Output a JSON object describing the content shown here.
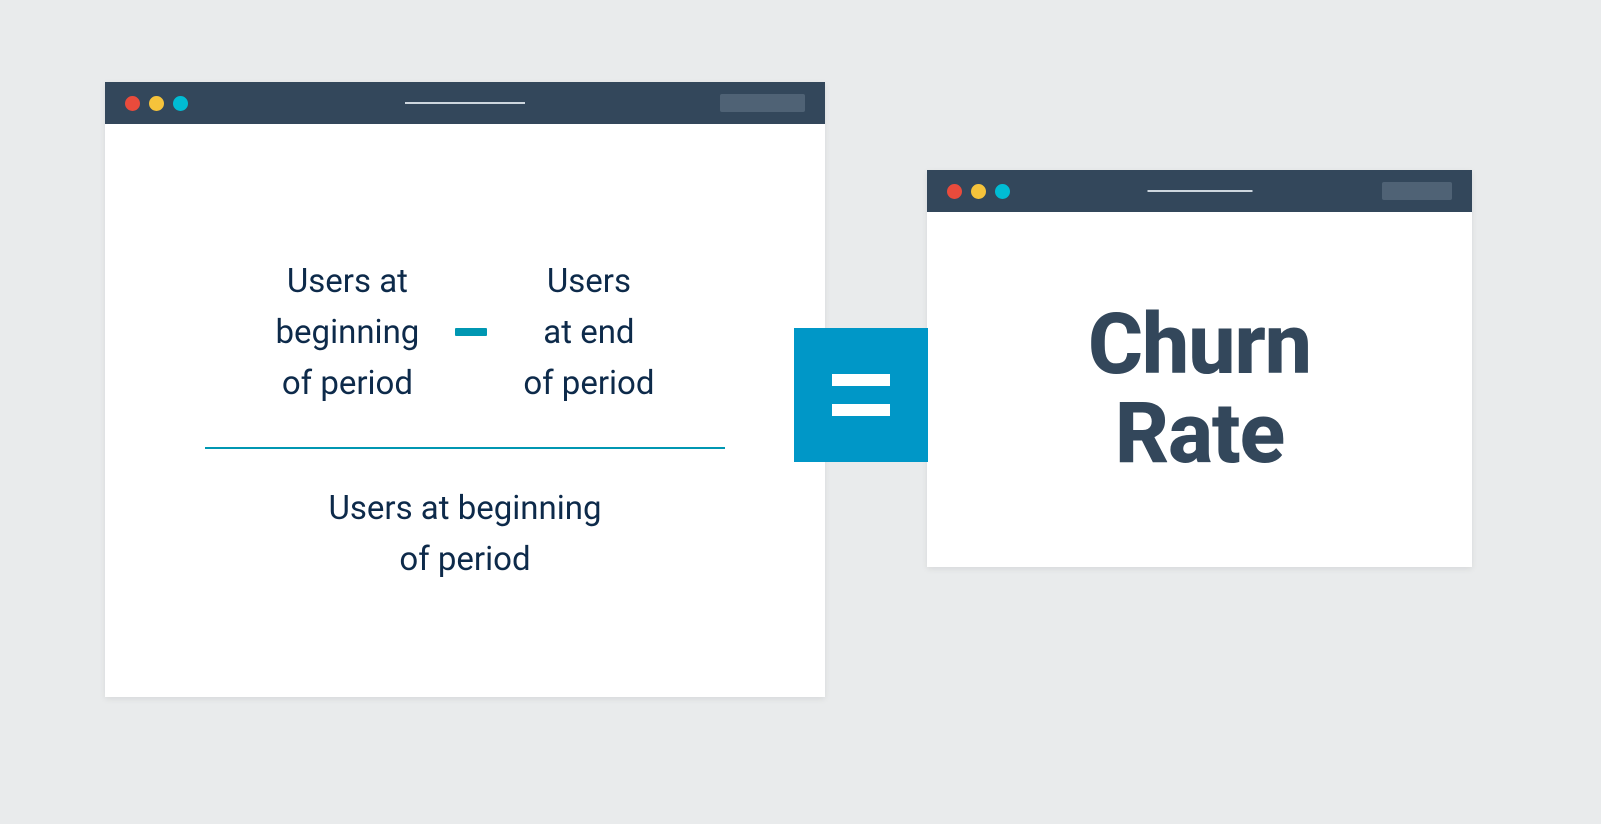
{
  "colors": {
    "background": "#e9ebec",
    "titlebar": "#33475b",
    "accent_teal": "#0097b2",
    "equals_block": "#0097c7",
    "text_dark": "#0d2a4a",
    "result_text": "#33475b",
    "dot_red": "#e94b3c",
    "dot_yellow": "#f5c33b",
    "dot_teal": "#00bcd4"
  },
  "formula": {
    "numerator_left": "Users at\nbeginning\nof period",
    "operator": "minus",
    "numerator_right": "Users\nat end\nof period",
    "denominator": "Users at beginning\nof period"
  },
  "equals": {
    "symbol": "equals"
  },
  "result": {
    "label": "Churn\nRate"
  }
}
